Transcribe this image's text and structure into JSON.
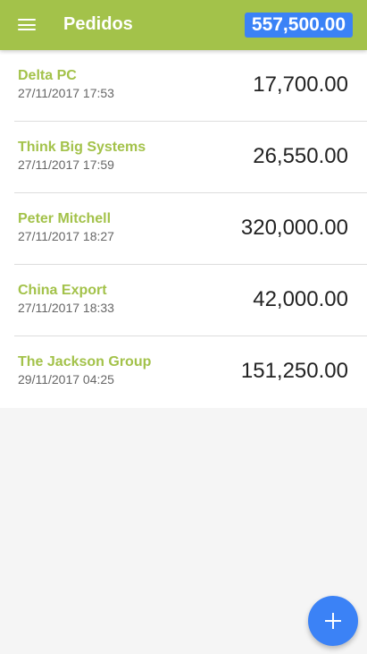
{
  "header": {
    "menu_icon": "menu-icon",
    "title": "Pedidos",
    "total": "557,500.00",
    "background_color": "#a3c24a",
    "badge_color": "#3b82f6"
  },
  "orders": [
    {
      "customer": "Delta PC",
      "date": "27/11/2017 17:53",
      "amount": "17,700.00"
    },
    {
      "customer": "Think Big Systems",
      "date": "27/11/2017 17:59",
      "amount": "26,550.00"
    },
    {
      "customer": "Peter Mitchell",
      "date": "27/11/2017 18:27",
      "amount": "320,000.00"
    },
    {
      "customer": "China Export",
      "date": "27/11/2017 18:33",
      "amount": "42,000.00"
    },
    {
      "customer": "The Jackson Group",
      "date": "29/11/2017 04:25",
      "amount": "151,250.00"
    }
  ],
  "fab": {
    "icon": "plus-icon",
    "color": "#3b82f6"
  }
}
